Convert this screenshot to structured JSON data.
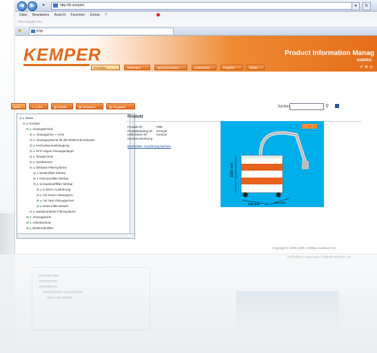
{
  "browser": {
    "address": "http://lk-vm/pim/",
    "menu": [
      "Datei",
      "Bearbeiten",
      "Ansicht",
      "Favoriten",
      "Extras",
      "?"
    ],
    "favorites_text": "PIM Vorgabe Fixe",
    "tab_title": "PIM"
  },
  "header": {
    "logo": "KEMPER",
    "title": "Product Information Manag",
    "company": "KEMPER",
    "nav": [
      {
        "label": "Produkte",
        "active": true
      },
      {
        "label": "Verbinden",
        "active": false
      },
      {
        "label": "Synchronisation",
        "active": false
      },
      {
        "label": "Dokumente",
        "active": false
      },
      {
        "label": "Projekte",
        "active": false
      },
      {
        "label": "Setup",
        "active": false
      }
    ]
  },
  "toolbar": {
    "buttons": [
      {
        "label": "Neu",
        "active": true
      },
      {
        "label": "Links",
        "active": false
      },
      {
        "label": "Details",
        "active": false
      },
      {
        "label": "Varianten",
        "active": false
      },
      {
        "label": "Vergleich",
        "active": false
      }
    ],
    "search_label": "Suchen"
  },
  "tree": {
    "items": [
      {
        "label": "Basis",
        "level": 0,
        "toggle": "⊟",
        "icon": "ⅎ"
      },
      {
        "label": "Kemper",
        "level": 1,
        "toggle": "⊟",
        "icon": "ⅎ"
      },
      {
        "label": "Absaugtechnik",
        "level": 2,
        "toggle": "⊟",
        "icon": "ⅎ"
      },
      {
        "label": "Absaugarme + Arme",
        "level": 3,
        "toggle": "⊞",
        "icon": "ⅎ"
      },
      {
        "label": "Absaugsysteme für die Elektronik-Industrie",
        "level": 3,
        "toggle": "⊞",
        "icon": "ⅎ"
      },
      {
        "label": "Hochvakuumabsaugung",
        "level": 3,
        "toggle": "⊞",
        "icon": "ⅎ"
      },
      {
        "label": "KFZ-Abgas-Absauganlagen",
        "level": 3,
        "toggle": "⊞",
        "icon": "ⅎ"
      },
      {
        "label": "Saugtechnik",
        "level": 3,
        "toggle": "⊞",
        "icon": "ⅎ"
      },
      {
        "label": "Ventilatoren",
        "level": 3,
        "toggle": "⊞",
        "icon": "ⅎ"
      },
      {
        "label": "fahrbare Filtersysteme",
        "level": 3,
        "toggle": "⊟",
        "icon": "ⅎ"
      },
      {
        "label": "Elektrofilter fahrbar",
        "level": 4,
        "toggle": "⊞",
        "icon": "ⅎ"
      },
      {
        "label": "Patronenfilter fahrbar",
        "level": 4,
        "toggle": "⊞",
        "icon": "ⅎ"
      },
      {
        "label": "Schwebstofffilter fahrbar",
        "level": 4,
        "toggle": "⊟",
        "icon": "ⅎ"
      },
      {
        "label": "in BGIA-Ausführung",
        "level": 5,
        "toggle": "⊞",
        "icon": "ⅎ"
      },
      {
        "label": "mit einem Absaugarm",
        "level": 5,
        "toggle": "⊞",
        "icon": "ⅎ"
      },
      {
        "label": "mit zwei Absaugarmen",
        "level": 5,
        "toggle": "⊞",
        "icon": "ⅎ"
      },
      {
        "label": "Serie Filter-Master",
        "level": 5,
        "toggle": "⊞",
        "icon": "ⅎ"
      },
      {
        "label": "wandmontierte Filtersysteme",
        "level": 3,
        "toggle": "⊞",
        "icon": "ⅎ"
      },
      {
        "label": "Absaugtische",
        "level": 2,
        "toggle": "⊞",
        "icon": "ⅎ"
      },
      {
        "label": "Arbeitsschutz",
        "level": 2,
        "toggle": "⊞",
        "icon": "ⅎ"
      },
      {
        "label": "Elektrodenfilter",
        "level": 2,
        "toggle": "⊞",
        "icon": "ⅎ"
      }
    ]
  },
  "product": {
    "title": "Produkt",
    "fields": [
      {
        "key": "Produkt-ID",
        "value": "PBE"
      },
      {
        "key": "Produktkatalog-ID",
        "value": "Kemper"
      },
      {
        "key": "Lieferanten-ID",
        "value": "Kemper"
      },
      {
        "key": "Kurzbeschreibung",
        "value": ""
      }
    ],
    "links": [
      "Bearbeiten",
      "Zuordnung löschen"
    ],
    "image_dims": {
      "h1": "1025 mm",
      "w": "800 mm",
      "d": "665 mm"
    }
  },
  "footer": {
    "copyright": "Copyright © 2000-2009. Köhlbau Software AG"
  },
  "colors": {
    "accent": "#e06a1b",
    "product_bg": "#00aeea",
    "link": "#1b4fa0"
  }
}
